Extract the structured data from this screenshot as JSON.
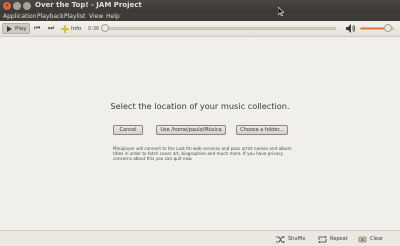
{
  "window": {
    "title": "Over the Top! - JAM Project",
    "controls": {
      "close": "×",
      "minimize": "",
      "maximize": ""
    }
  },
  "menu": [
    "Application",
    "Playback",
    "Playlist",
    "View",
    "Help"
  ],
  "toolbar": {
    "play_label": "Play",
    "info_label": "Info",
    "time": "0:36",
    "seek_progress": 0.0,
    "volume_level": 0.75
  },
  "main": {
    "heading": "Select the location of your music collection.",
    "buttons": {
      "cancel": "Cancel",
      "use": "Use /home/paulo/Música",
      "choose": "Choose a folder..."
    },
    "notice": "Miniplayer will connect to the Last.fm web services and pass artist names and album titles in order to fetch cover art, biographies and much more. If you have privacy concerns about this you can quit now."
  },
  "bottom": {
    "shuffle": "Shuffle",
    "repeat": "Repeat",
    "clear": "Clear"
  },
  "colors": {
    "accent": "#e06d2a",
    "titlebar": "#3e3c39",
    "background": "#f1efeb"
  }
}
